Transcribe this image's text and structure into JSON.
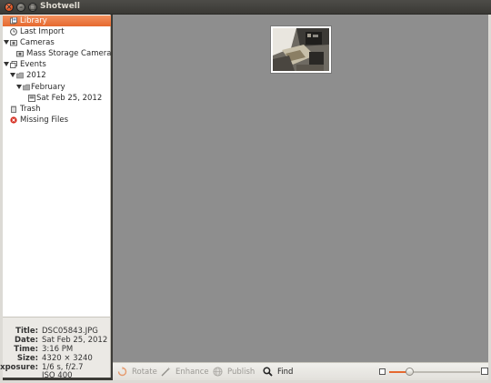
{
  "window": {
    "title": "Shotwell"
  },
  "sidebar": {
    "items": [
      {
        "label": "Library",
        "icon": "library-icon",
        "selected": true
      },
      {
        "label": "Last Import",
        "icon": "last-import-icon"
      },
      {
        "label": "Cameras",
        "icon": "camera-icon"
      },
      {
        "label": "Mass Storage Camera",
        "icon": "camera-device-icon"
      },
      {
        "label": "Events",
        "icon": "events-icon"
      },
      {
        "label": "2012",
        "icon": "folder-icon"
      },
      {
        "label": "February",
        "icon": "folder-icon"
      },
      {
        "label": "Sat Feb 25, 2012",
        "icon": "event-icon"
      },
      {
        "label": "Trash",
        "icon": "trash-icon"
      },
      {
        "label": "Missing Files",
        "icon": "missing-files-icon"
      }
    ]
  },
  "info": {
    "title_key": "Title:",
    "title_val": "DSC05843.JPG",
    "date_key": "Date:",
    "date_val": "Sat Feb 25, 2012",
    "time_key": "Time:",
    "time_val": "3:16 PM",
    "size_key": "Size:",
    "size_val": "4320 × 3240",
    "exposure_key": "Exposure:",
    "exposure_val": "1/6 s, f/2.7",
    "iso_val": "ISO 400"
  },
  "toolbar": {
    "rotate_label": "Rotate",
    "enhance_label": "Enhance",
    "publish_label": "Publish",
    "find_label": "Find"
  },
  "zoom": {
    "level": 0.22
  },
  "colors": {
    "accent": "#e5692f",
    "canvas": "#8e8e8e"
  }
}
